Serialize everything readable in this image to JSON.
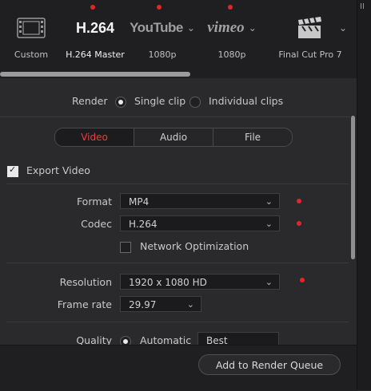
{
  "presets": [
    {
      "label": "Custom",
      "logo": "film-icon",
      "dot": false
    },
    {
      "label": "H.264 Master",
      "logo_text": "H.264",
      "dot": true
    },
    {
      "label": "1080p",
      "logo_text": "YouTube",
      "dot": true
    },
    {
      "label": "1080p",
      "logo_text": "vimeo",
      "dot": true
    },
    {
      "label": "Final Cut Pro 7",
      "logo": "clapperboard-icon",
      "dot": false
    }
  ],
  "right_strip_text": "II",
  "render": {
    "label": "Render",
    "single_clip": "Single clip",
    "individual_clips": "Individual clips",
    "selected": "single_clip"
  },
  "tabs": [
    "Video",
    "Audio",
    "File"
  ],
  "active_tab": "Video",
  "export_video": {
    "label": "Export Video",
    "checked": true
  },
  "format": {
    "label": "Format",
    "value": "MP4"
  },
  "codec": {
    "label": "Codec",
    "value": "H.264"
  },
  "network_optimization": {
    "label": "Network Optimization",
    "checked": false
  },
  "resolution": {
    "label": "Resolution",
    "value": "1920 x 1080 HD"
  },
  "frame_rate": {
    "label": "Frame rate",
    "value": "29.97"
  },
  "quality": {
    "label": "Quality",
    "automatic": "Automatic",
    "value": "Best"
  },
  "add_button": "Add to Render Queue",
  "colors": {
    "accent_red": "#e0262b",
    "background": "#2a2a2d",
    "panel": "#1f1f22"
  }
}
